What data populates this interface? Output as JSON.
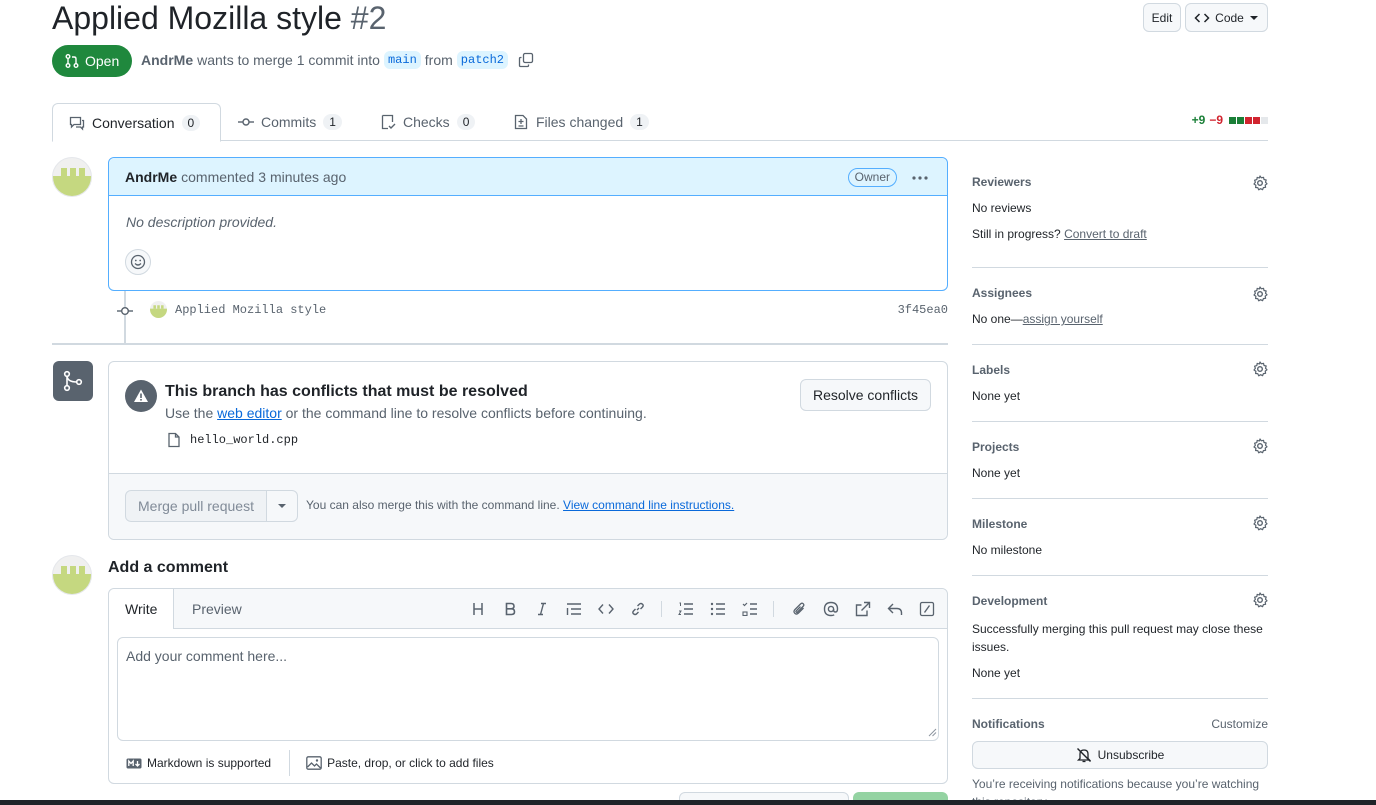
{
  "header": {
    "title": "Applied Mozilla style",
    "number": "#2",
    "edit_label": "Edit",
    "code_label": "Code"
  },
  "pr_meta": {
    "state": "Open",
    "author": "AndrMe",
    "text_merge": "wants to merge 1 commit into",
    "base_branch": "main",
    "text_from": "from",
    "head_branch": "patch2"
  },
  "tabs": [
    {
      "label": "Conversation",
      "count": "0"
    },
    {
      "label": "Commits",
      "count": "1"
    },
    {
      "label": "Checks",
      "count": "0"
    },
    {
      "label": "Files changed",
      "count": "1"
    }
  ],
  "diffstat": {
    "additions": "+9",
    "deletions": "−9"
  },
  "comment": {
    "author": "AndrMe",
    "action": "commented",
    "time": "3 minutes ago",
    "role": "Owner",
    "body": "No description provided."
  },
  "commit": {
    "message": "Applied Mozilla style",
    "sha": "3f45ea0"
  },
  "mergebox": {
    "title": "This branch has conflicts that must be resolved",
    "sub_prefix": "Use the",
    "sub_link": "web editor",
    "sub_suffix": "or the command line to resolve conflicts before continuing.",
    "file": "hello_world.cpp",
    "resolve_label": "Resolve conflicts",
    "merge_label": "Merge pull request",
    "note": "You can also merge this with the command line.",
    "note_link": "View command line instructions."
  },
  "add_comment": {
    "heading": "Add a comment",
    "tab_write": "Write",
    "tab_preview": "Preview",
    "placeholder": "Add your comment here...",
    "markdown_note": "Markdown is supported",
    "files_note": "Paste, drop, or click to add files"
  },
  "sidebar": {
    "reviewers": {
      "heading": "Reviewers",
      "value": "No reviews",
      "progress_q": "Still in progress?",
      "draft_link": "Convert to draft"
    },
    "assignees": {
      "heading": "Assignees",
      "value": "No one—",
      "link": "assign yourself"
    },
    "labels": {
      "heading": "Labels",
      "value": "None yet"
    },
    "projects": {
      "heading": "Projects",
      "value": "None yet"
    },
    "milestone": {
      "heading": "Milestone",
      "value": "No milestone"
    },
    "development": {
      "heading": "Development",
      "note": "Successfully merging this pull request may close these issues.",
      "value": "None yet"
    },
    "notifications": {
      "heading": "Notifications",
      "customize": "Customize",
      "unsubscribe": "Unsubscribe",
      "note": "You’re receiving notifications because you’re watching this repository."
    }
  },
  "colors": {
    "open_green": "#1f883d",
    "link_blue": "#0969da",
    "add": "#1a7f37",
    "del": "#d1242f",
    "avatar": "#c5d880"
  }
}
